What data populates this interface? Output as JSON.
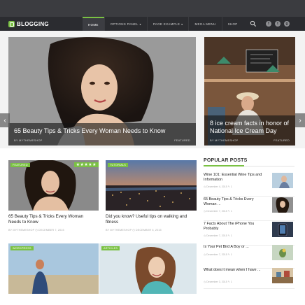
{
  "header": {
    "logo_text": "BLOGGING",
    "nav": [
      {
        "label": "HOME",
        "caret": false
      },
      {
        "label": "OPTIONS PANEL",
        "caret": true
      },
      {
        "label": "PAGE EXAMPLE",
        "caret": true
      },
      {
        "label": "MEGA MENU",
        "caret": false
      },
      {
        "label": "SHOP",
        "caret": false
      }
    ],
    "social_icons": [
      "facebook-icon",
      "twitter-icon",
      "google-plus-icon"
    ],
    "social_glyphs": [
      "f",
      "t",
      "g"
    ]
  },
  "slider": {
    "main": {
      "title": "65 Beauty Tips & Tricks Every Woman Needs to Know",
      "author": "BY MYTHEMESHOP",
      "tag": "FEATURED"
    },
    "side": {
      "title": "8 ice cream facts in honor of National Ice Cream Day",
      "author": "BY MYTHEMESHOP",
      "tag": "FEATURED"
    },
    "prev": "‹",
    "next": "›"
  },
  "posts": [
    {
      "label": "FEATURED",
      "stars": "★★★★★",
      "title": "65 Beauty Tips & Tricks Every Woman Needs to Know",
      "meta": "BY MYTHEMESHOP     ◷ DECEMBER 7, 2015"
    },
    {
      "label": "TUTORIALS",
      "title": "Did you know? Useful tips on walking and fitness",
      "meta": "BY MYTHEMESHOP     ◷ DECEMBER 5, 2015"
    },
    {
      "label": "WORDPRESS"
    },
    {
      "label": "ARTICLES"
    }
  ],
  "sidebar": {
    "heading": "POPULAR POSTS",
    "items": [
      {
        "title": "Wine 101: Essential Wine Tips and Information",
        "meta": "◷ December 4, 2015    ✎ 1"
      },
      {
        "title": "65 Beauty Tips & Tricks Every Woman ...",
        "meta": "◷ December 7, 2015    ✎ 1"
      },
      {
        "title": "7 Facts About The iPhone You Probably",
        "meta": "◷ December 7, 2015    ✎ 1"
      },
      {
        "title": "Is Your Pet Bird A Boy or ...",
        "meta": "◷ December 7, 2015    ✎ 1"
      },
      {
        "title": "What does it mean when I have ...",
        "meta": "◷ December 3, 2015    ✎ 1"
      }
    ]
  },
  "colors": {
    "accent": "#7ac143",
    "header_bg": "#2b2c30"
  }
}
